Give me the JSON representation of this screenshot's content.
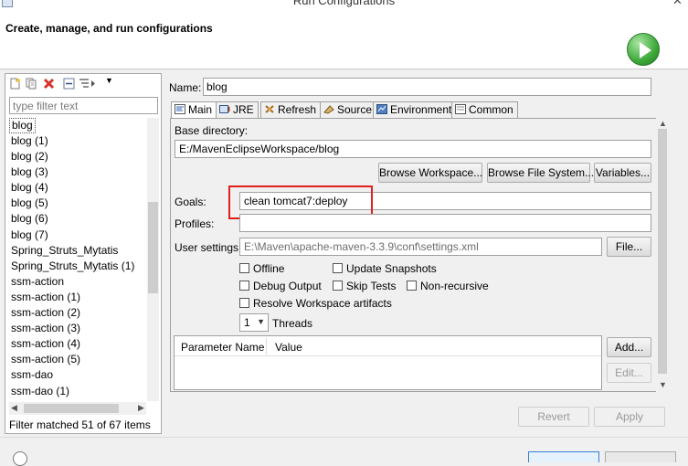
{
  "window": {
    "title": "Run Configurations"
  },
  "banner": {
    "title": "Create, manage, and run configurations"
  },
  "sidebar": {
    "filter_placeholder": "type filter text",
    "items": [
      "blog",
      "blog (1)",
      "blog (2)",
      "blog (3)",
      "blog (4)",
      "blog (5)",
      "blog (6)",
      "blog (7)",
      "Spring_Struts_Mytatis",
      "Spring_Struts_Mytatis (1)",
      "ssm-action",
      "ssm-action (1)",
      "ssm-action (2)",
      "ssm-action (3)",
      "ssm-action (4)",
      "ssm-action (5)",
      "ssm-dao",
      "ssm-dao (1)"
    ],
    "selected_index": 0,
    "filter_status": "Filter matched 51 of 67 items"
  },
  "config": {
    "name_label": "Name:",
    "name_value": "blog",
    "tabs": [
      "Main",
      "JRE",
      "Refresh",
      "Source",
      "Environment",
      "Common"
    ],
    "active_tab": "Main",
    "base_dir_label": "Base directory:",
    "base_dir_value": "E:/MavenEclipseWorkspace/blog",
    "browse_workspace": "Browse Workspace...",
    "browse_fs": "Browse File System...",
    "variables": "Variables...",
    "goals_label": "Goals:",
    "goals_value": "clean tomcat7:deploy",
    "profiles_label": "Profiles:",
    "profiles_value": "",
    "user_settings_label": "User settings:",
    "user_settings_value": "E:\\Maven\\apache-maven-3.3.9\\conf\\settings.xml",
    "file_button": "File...",
    "checkboxes": {
      "offline": "Offline",
      "update_snapshots": "Update Snapshots",
      "debug_output": "Debug Output",
      "skip_tests": "Skip Tests",
      "non_recursive": "Non-recursive",
      "resolve_ws": "Resolve Workspace artifacts"
    },
    "threads_value": "1",
    "threads_label": "Threads",
    "param_columns": [
      "Parameter Name",
      "Value"
    ],
    "add_button": "Add...",
    "edit_button": "Edit...",
    "revert_button": "Revert",
    "apply_button": "Apply"
  }
}
